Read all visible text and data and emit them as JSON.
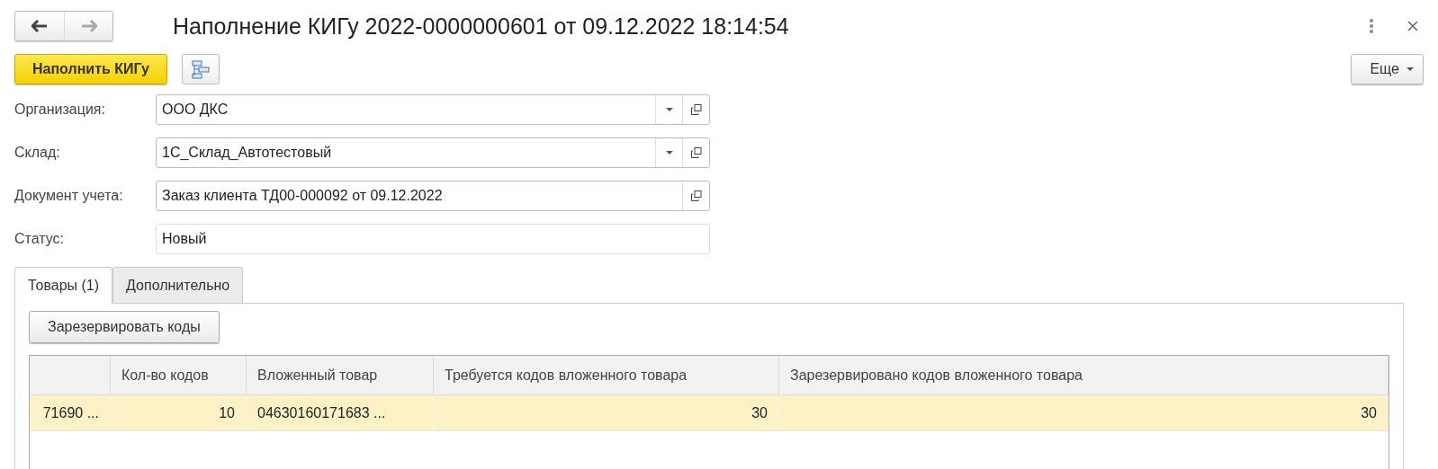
{
  "window": {
    "title": "Наполнение КИГу 2022-0000000601 от 09.12.2022 18:14:54"
  },
  "toolbar": {
    "primary_button": "Наполнить КИГу",
    "more_button": "Еще"
  },
  "fields": [
    {
      "label": "Организация:",
      "value": "ООО ДКС",
      "kind": "select"
    },
    {
      "label": "Склад:",
      "value": "1С_Склад_Автотестовый",
      "kind": "select"
    },
    {
      "label": "Документ учета:",
      "value": "Заказ клиента ТД00-000092 от 09.12.2022",
      "kind": "ref"
    },
    {
      "label": "Статус:",
      "value": "Новый",
      "kind": "text"
    }
  ],
  "tabs": [
    {
      "label": "Товары (1)",
      "selected": true
    },
    {
      "label": "Дополнительно",
      "selected": false
    }
  ],
  "tab_button": "Зарезервировать коды",
  "table": {
    "columns": [
      null,
      "Кол-во кодов",
      "Вложенный товар",
      "Требуется кодов вложенного товара",
      "Зарезервировано кодов вложенного товара"
    ],
    "rows": [
      {
        "selected": true,
        "cells": [
          "71690 ...",
          "10",
          "04630160171683 ...",
          "30",
          "30"
        ]
      }
    ]
  }
}
